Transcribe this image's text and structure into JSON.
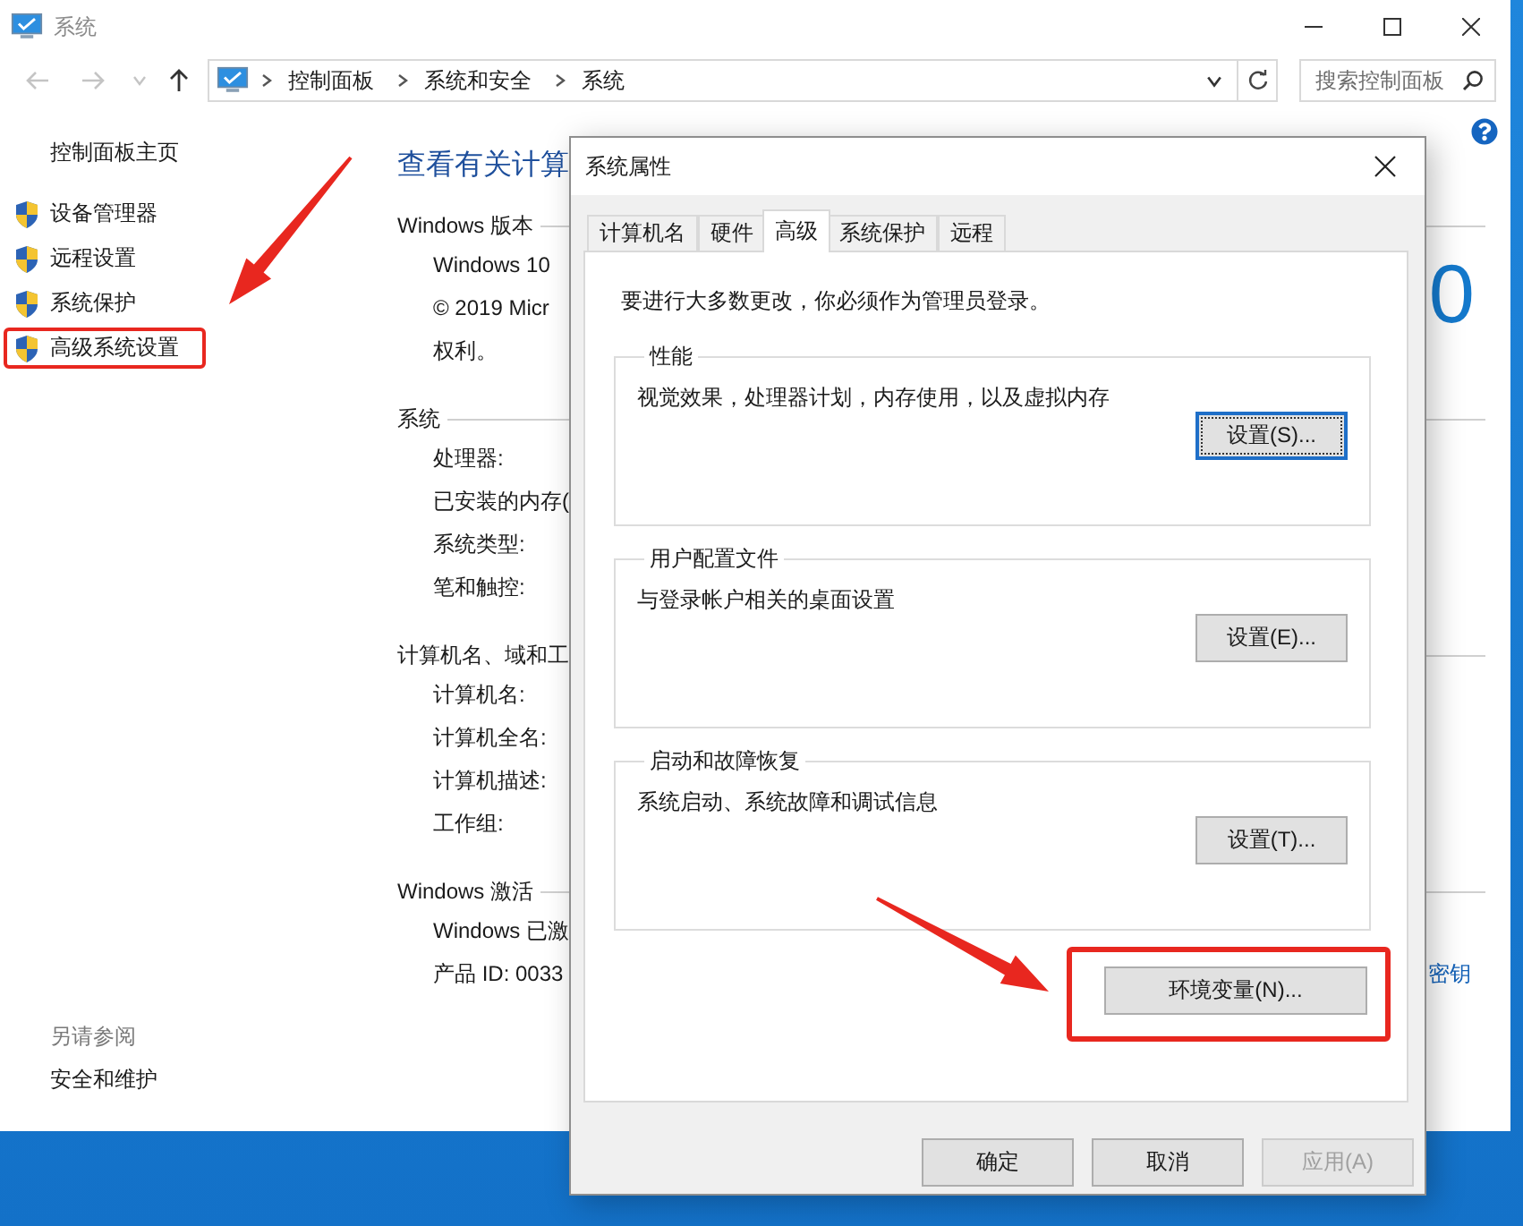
{
  "window": {
    "title": "系统"
  },
  "nav_buttons": [
    {
      "kind": "back",
      "disabled": true
    },
    {
      "kind": "forward",
      "disabled": true
    },
    {
      "kind": "recent",
      "disabled": true
    },
    {
      "kind": "up",
      "disabled": false
    }
  ],
  "breadcrumbs": [
    "控制面板",
    "系统和安全",
    "系统"
  ],
  "search": {
    "placeholder": "搜索控制面板"
  },
  "sidebar": {
    "home": "控制面板主页",
    "items": [
      {
        "label": "设备管理器",
        "highlighted": false
      },
      {
        "label": "远程设置",
        "highlighted": false
      },
      {
        "label": "系统保护",
        "highlighted": false
      },
      {
        "label": "高级系统设置",
        "highlighted": true
      }
    ],
    "see_also_title": "另请参阅",
    "see_also": [
      "安全和维护"
    ]
  },
  "content": {
    "title": "查看有关计算",
    "sections": [
      {
        "heading": "Windows 版本",
        "rows": [
          "Windows 10",
          "© 2019 Micr",
          "权利。"
        ],
        "aside": {
          "kind": "logo-text",
          "text": "0"
        }
      },
      {
        "heading": "系统",
        "rows": [
          "处理器:",
          "已安装的内存(",
          "系统类型:",
          "笔和触控:"
        ]
      },
      {
        "heading": "计算机名、域和工",
        "rows": [
          "计算机名:",
          "计算机全名:",
          "计算机描述:",
          "工作组:"
        ]
      },
      {
        "heading": "Windows 激活",
        "rows": [
          "Windows 已激",
          "产品 ID: 0033"
        ],
        "aside": {
          "kind": "link",
          "text": "密钥"
        }
      }
    ]
  },
  "dialog": {
    "title": "系统属性",
    "tabs": [
      {
        "label": "计算机名",
        "selected": false
      },
      {
        "label": "硬件",
        "selected": false
      },
      {
        "label": "高级",
        "selected": true
      },
      {
        "label": "系统保护",
        "selected": false
      },
      {
        "label": "远程",
        "selected": false
      }
    ],
    "notice": "要进行大多数更改，你必须作为管理员登录。",
    "groups": [
      {
        "title": "性能",
        "description": "视觉效果，处理器计划，内存使用，以及虚拟内存",
        "button": {
          "label": "设置(S)...",
          "focused": true
        }
      },
      {
        "title": "用户配置文件",
        "description": "与登录帐户相关的桌面设置",
        "button": {
          "label": "设置(E)...",
          "focused": false
        }
      },
      {
        "title": "启动和故障恢复",
        "description": "系统启动、系统故障和调试信息",
        "button": {
          "label": "设置(T)...",
          "focused": false
        }
      }
    ],
    "env_button": {
      "label": "环境变量(N)...",
      "highlighted": true
    },
    "footer_buttons": [
      {
        "label": "确定",
        "disabled": false
      },
      {
        "label": "取消",
        "disabled": false
      },
      {
        "label": "应用(A)",
        "disabled": true
      }
    ]
  }
}
